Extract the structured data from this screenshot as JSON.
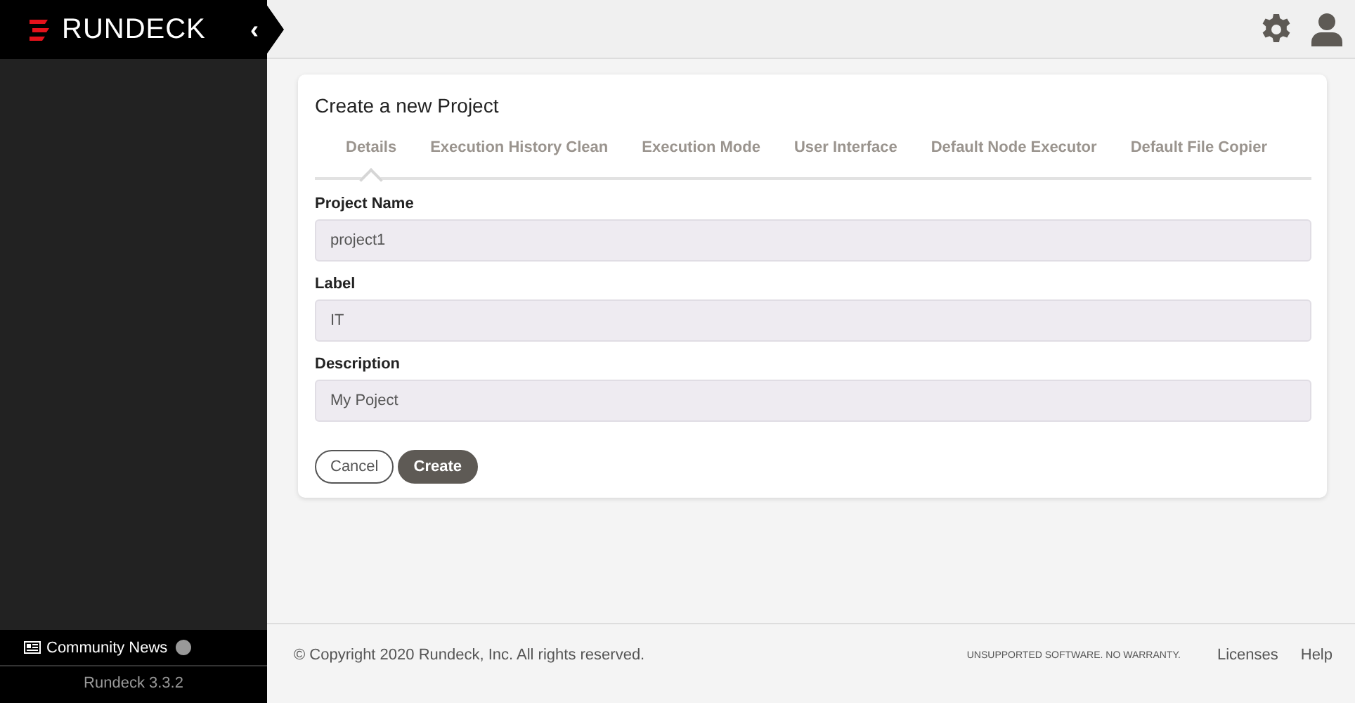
{
  "brand": {
    "name": "RUNDECK"
  },
  "sidebar": {
    "toggle": "‹",
    "community_news": "Community News",
    "version": "Rundeck 3.3.2"
  },
  "page": {
    "title": "Create a new Project",
    "tabs": [
      {
        "label": "Details",
        "selected": true
      },
      {
        "label": "Execution History Clean",
        "selected": false
      },
      {
        "label": "Execution Mode",
        "selected": false
      },
      {
        "label": "User Interface",
        "selected": false
      },
      {
        "label": "Default Node Executor",
        "selected": false
      },
      {
        "label": "Default File Copier",
        "selected": false
      }
    ],
    "fields": [
      {
        "label": "Project Name",
        "value": "project1"
      },
      {
        "label": "Label",
        "value": "IT"
      },
      {
        "label": "Description",
        "value": "My Poject"
      }
    ],
    "buttons": [
      {
        "label": "Cancel",
        "kind": "secondary"
      },
      {
        "label": "Create",
        "kind": "primary"
      }
    ]
  },
  "footer": {
    "copyright": "© Copyright 2020 Rundeck, Inc. All rights reserved.",
    "warranty": "UNSUPPORTED SOFTWARE. NO WARRANTY.",
    "links": [
      "Licenses",
      "Help"
    ]
  }
}
